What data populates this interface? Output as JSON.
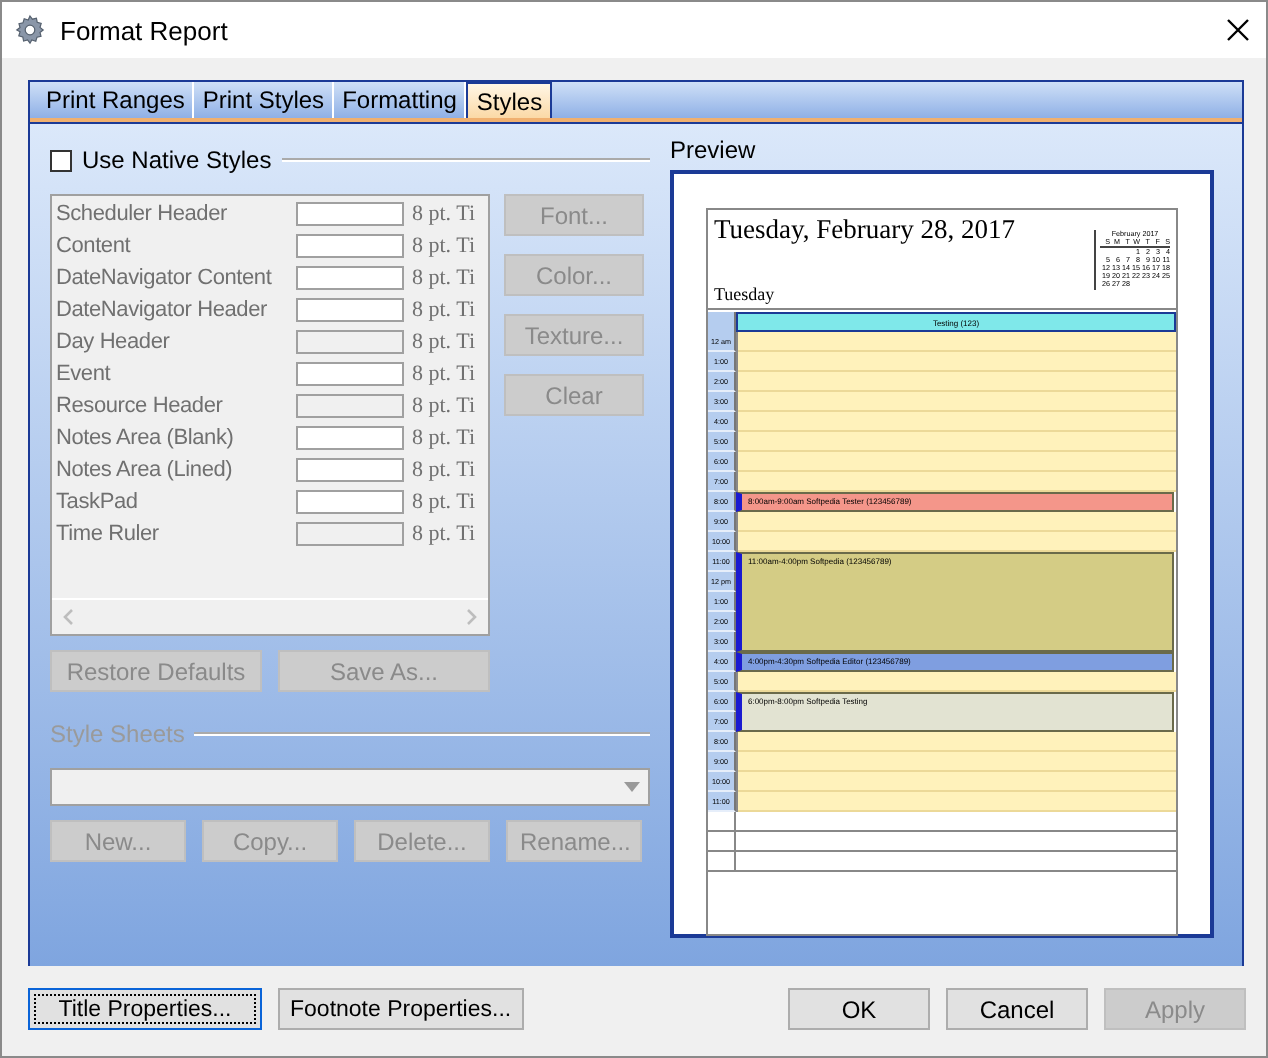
{
  "window": {
    "title": "Format Report"
  },
  "tabs": [
    {
      "label": "Print Ranges",
      "selected": false
    },
    {
      "label": "Print Styles",
      "selected": false
    },
    {
      "label": "Formatting",
      "selected": false
    },
    {
      "label": "Styles",
      "selected": true
    }
  ],
  "native_styles": {
    "label": "Use Native Styles",
    "checked": false
  },
  "styles": [
    {
      "name": "Scheduler Header",
      "color": "#ffffff",
      "font": "8 pt. Ti"
    },
    {
      "name": "Content",
      "color": "#ffffff",
      "font": "8 pt. Ti"
    },
    {
      "name": "DateNavigator Content",
      "color": "#ffffff",
      "font": "8 pt. Ti"
    },
    {
      "name": "DateNavigator Header",
      "color": "#ffffff",
      "font": "8 pt. Ti"
    },
    {
      "name": "Day Header",
      "color": "#f0f0f0",
      "font": "8 pt. Ti"
    },
    {
      "name": "Event",
      "color": "#ffffff",
      "font": "8 pt. Ti"
    },
    {
      "name": "Resource Header",
      "color": "#f0f0f0",
      "font": "8 pt. Ti"
    },
    {
      "name": "Notes Area (Blank)",
      "color": "#ffffff",
      "font": "8 pt. Ti"
    },
    {
      "name": "Notes Area (Lined)",
      "color": "#ffffff",
      "font": "8 pt. Ti"
    },
    {
      "name": "TaskPad",
      "color": "#ffffff",
      "font": "8 pt. Ti"
    },
    {
      "name": "Time Ruler",
      "color": "#f0f0f0",
      "font": "8 pt. Ti"
    }
  ],
  "style_buttons": [
    {
      "label": "Font...",
      "disabled": true
    },
    {
      "label": "Color...",
      "disabled": true
    },
    {
      "label": "Texture...",
      "disabled": true
    },
    {
      "label": "Clear",
      "disabled": true
    }
  ],
  "list_buttons": [
    {
      "label": "Restore Defaults",
      "disabled": true
    },
    {
      "label": "Save As...",
      "disabled": true
    }
  ],
  "style_sheets": {
    "label": "Style Sheets",
    "disabled": true,
    "buttons": [
      {
        "label": "New...",
        "disabled": true
      },
      {
        "label": "Copy...",
        "disabled": true
      },
      {
        "label": "Delete...",
        "disabled": true
      },
      {
        "label": "Rename...",
        "disabled": true
      }
    ]
  },
  "preview": {
    "label": "Preview",
    "date": "Tuesday, February 28, 2017",
    "day": "Tuesday",
    "mini_calendar": {
      "title": "February 2017",
      "weekdays": [
        "S",
        "M",
        "T",
        "W",
        "T",
        "F",
        "S"
      ],
      "weeks": [
        [
          "1",
          "2",
          "3",
          "4"
        ],
        [
          "5",
          "6",
          "7",
          "8",
          "9",
          "10",
          "11"
        ],
        [
          "12",
          "13",
          "14",
          "15",
          "16",
          "17",
          "18"
        ],
        [
          "19",
          "20",
          "21",
          "22",
          "23",
          "24",
          "25"
        ],
        [
          "26",
          "27",
          "28"
        ]
      ]
    },
    "resource": "Testing (123)",
    "blocks": [
      {
        "kind": "free",
        "hours": [
          "12 am",
          "1:00",
          "2:00",
          "3:00",
          "4:00",
          "5:00",
          "6:00",
          "7:00"
        ]
      },
      {
        "kind": "event",
        "text": "8:00am-9:00am Softpedia Tester (123456789)",
        "color": "#f4968a",
        "hours": [
          "8:00"
        ]
      },
      {
        "kind": "free",
        "hours": [
          "9:00",
          "10:00"
        ]
      },
      {
        "kind": "event",
        "text": "11:00am-4:00pm Softpedia (123456789)",
        "color": "#d4cc85",
        "hours": [
          "11:00",
          "12 pm",
          "1:00",
          "2:00",
          "3:00"
        ]
      },
      {
        "kind": "event",
        "text": "4:00pm-4:30pm Softpedia Editor (123456789)",
        "color": "#7f9ee0",
        "hours": [
          "4:00"
        ]
      },
      {
        "kind": "free",
        "hours": [
          "5:00"
        ]
      },
      {
        "kind": "event",
        "text": "6:00pm-8:00pm Softpedia Testing",
        "color": "#e2e3d2",
        "hours": [
          "6:00",
          "7:00"
        ]
      },
      {
        "kind": "free",
        "hours": [
          "8:00",
          "9:00",
          "10:00",
          "11:00"
        ]
      }
    ]
  },
  "footer_buttons": [
    {
      "label": "Title Properties...",
      "disabled": false,
      "focused": true
    },
    {
      "label": "Footnote Properties...",
      "disabled": false,
      "focused": false
    }
  ],
  "dialog_buttons": [
    {
      "label": "OK",
      "disabled": false
    },
    {
      "label": "Cancel",
      "disabled": false
    },
    {
      "label": "Apply",
      "disabled": true
    }
  ]
}
